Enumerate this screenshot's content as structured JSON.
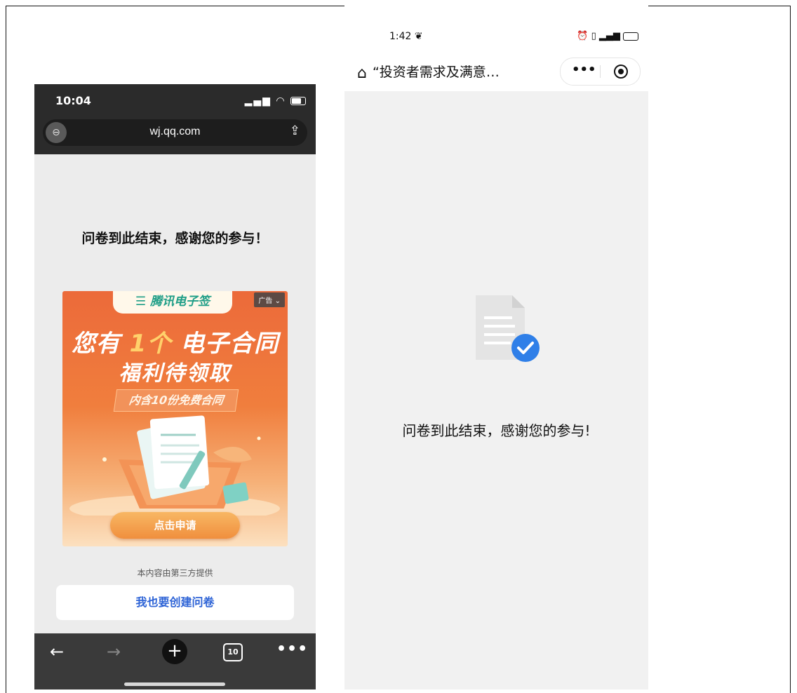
{
  "left_phone": {
    "status": {
      "time": "10:04"
    },
    "url_bar": {
      "url": "wj.qq.com"
    },
    "thanks_text": "问卷到此结束，感谢您的参与！",
    "ad": {
      "brand": "腾讯电子签",
      "badge": "广告",
      "title_prefix": "您有",
      "title_highlight": "1个",
      "title_suffix": "电子合同",
      "title_line2": "福利待领取",
      "subtitle": "内含10份免费合同",
      "button": "点击申请"
    },
    "provider_text": "本内容由第三方提供",
    "create_button": "我也要创建问卷",
    "toolbar": {
      "tabs_count": "10"
    }
  },
  "right_phone": {
    "status": {
      "time": "1:42"
    },
    "title": "“投资者需求及满意…",
    "thanks_text": "问卷到此结束，感谢您的参与!",
    "accent_color": "#2f7fe8"
  }
}
